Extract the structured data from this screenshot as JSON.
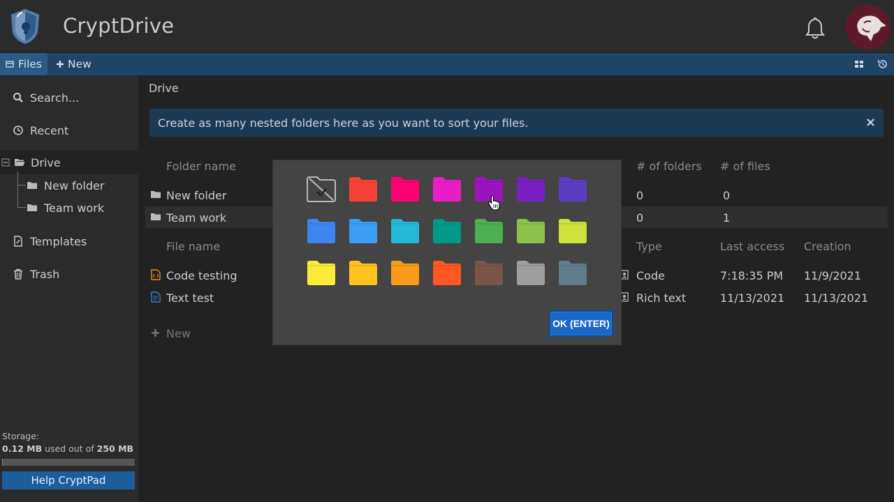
{
  "app": {
    "title": "CryptDrive"
  },
  "toolbar": {
    "files_label": "Files",
    "new_label": "New"
  },
  "sidebar": {
    "search_placeholder": "Search...",
    "recent": "Recent",
    "drive": "Drive",
    "tree": [
      "New folder",
      "Team work"
    ],
    "templates": "Templates",
    "trash": "Trash",
    "storage_label": "Storage:",
    "storage_used": "0.12 MB",
    "storage_mid": " used out of ",
    "storage_total": "250 MB",
    "storage_fraction": 0.0005,
    "help_label": "Help CryptPad"
  },
  "main": {
    "breadcrumb": "Drive",
    "info": "Create as many nested folders here as you want to sort your files.",
    "folder_headers": {
      "name": "Folder name",
      "folders": "# of folders",
      "files": "# of files"
    },
    "folders": [
      {
        "name": "New folder",
        "folders": "0",
        "files": "0"
      },
      {
        "name": "Team work",
        "folders": "0",
        "files": "1"
      }
    ],
    "file_headers": {
      "name": "File name",
      "type": "Type",
      "last_access": "Last access",
      "creation": "Creation"
    },
    "files": [
      {
        "name": "Code testing",
        "type": "Code",
        "last_access": "7:18:35 PM",
        "creation": "11/9/2021"
      },
      {
        "name": "Text test",
        "type": "Rich text",
        "last_access": "11/13/2021",
        "creation": "11/13/2021"
      }
    ],
    "new_label": "New"
  },
  "modal": {
    "ok_label": "OK (ENTER)",
    "colors": [
      [
        "none",
        "#f44336",
        "#ff0073",
        "#e91ec8",
        "#9c13bf",
        "#7a1fc4",
        "#5b3ec0"
      ],
      [
        "#3d86f0",
        "#3a9ef5",
        "#25b8d6",
        "#00998a",
        "#4caf50",
        "#8bc34a",
        "#cde23a"
      ],
      [
        "#fbeb3b",
        "#fec21e",
        "#fb9a1a",
        "#ff5722",
        "#7a5548",
        "#9e9e9e",
        "#607d8b"
      ]
    ]
  }
}
